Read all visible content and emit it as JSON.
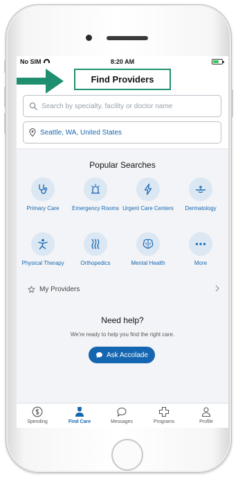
{
  "status_bar": {
    "carrier": "No SIM",
    "time": "8:20 AM"
  },
  "header": {
    "title": "Find Providers",
    "search_placeholder": "Search by specialty, facility or doctor name",
    "location": "Seattle, WA, United States"
  },
  "popular": {
    "title": "Popular Searches",
    "items": [
      {
        "label": "Primary Care",
        "icon": "stethoscope-icon"
      },
      {
        "label": "Emergency Rooms",
        "icon": "siren-icon"
      },
      {
        "label": "Urgent Care Centers",
        "icon": "lightning-icon"
      },
      {
        "label": "Dermatology",
        "icon": "skin-icon"
      },
      {
        "label": "Physical Therapy",
        "icon": "figure-icon"
      },
      {
        "label": "Orthopedics",
        "icon": "bones-icon"
      },
      {
        "label": "Mental Health",
        "icon": "brain-icon"
      },
      {
        "label": "More",
        "icon": "more-icon"
      }
    ]
  },
  "my_providers": {
    "label": "My Providers"
  },
  "help": {
    "title": "Need help?",
    "text": "We're ready to help you find the right care.",
    "button": "Ask Accolade"
  },
  "tabs": [
    {
      "label": "Spending",
      "icon": "dollar-icon"
    },
    {
      "label": "Find Care",
      "icon": "doctor-icon",
      "active": true
    },
    {
      "label": "Messages",
      "icon": "chat-icon"
    },
    {
      "label": "Programs",
      "icon": "plus-icon"
    },
    {
      "label": "Profile",
      "icon": "person-icon"
    }
  ],
  "colors": {
    "accent": "#1566b0",
    "highlight": "#1f8f70",
    "icon_bg": "#dbe7f3"
  }
}
